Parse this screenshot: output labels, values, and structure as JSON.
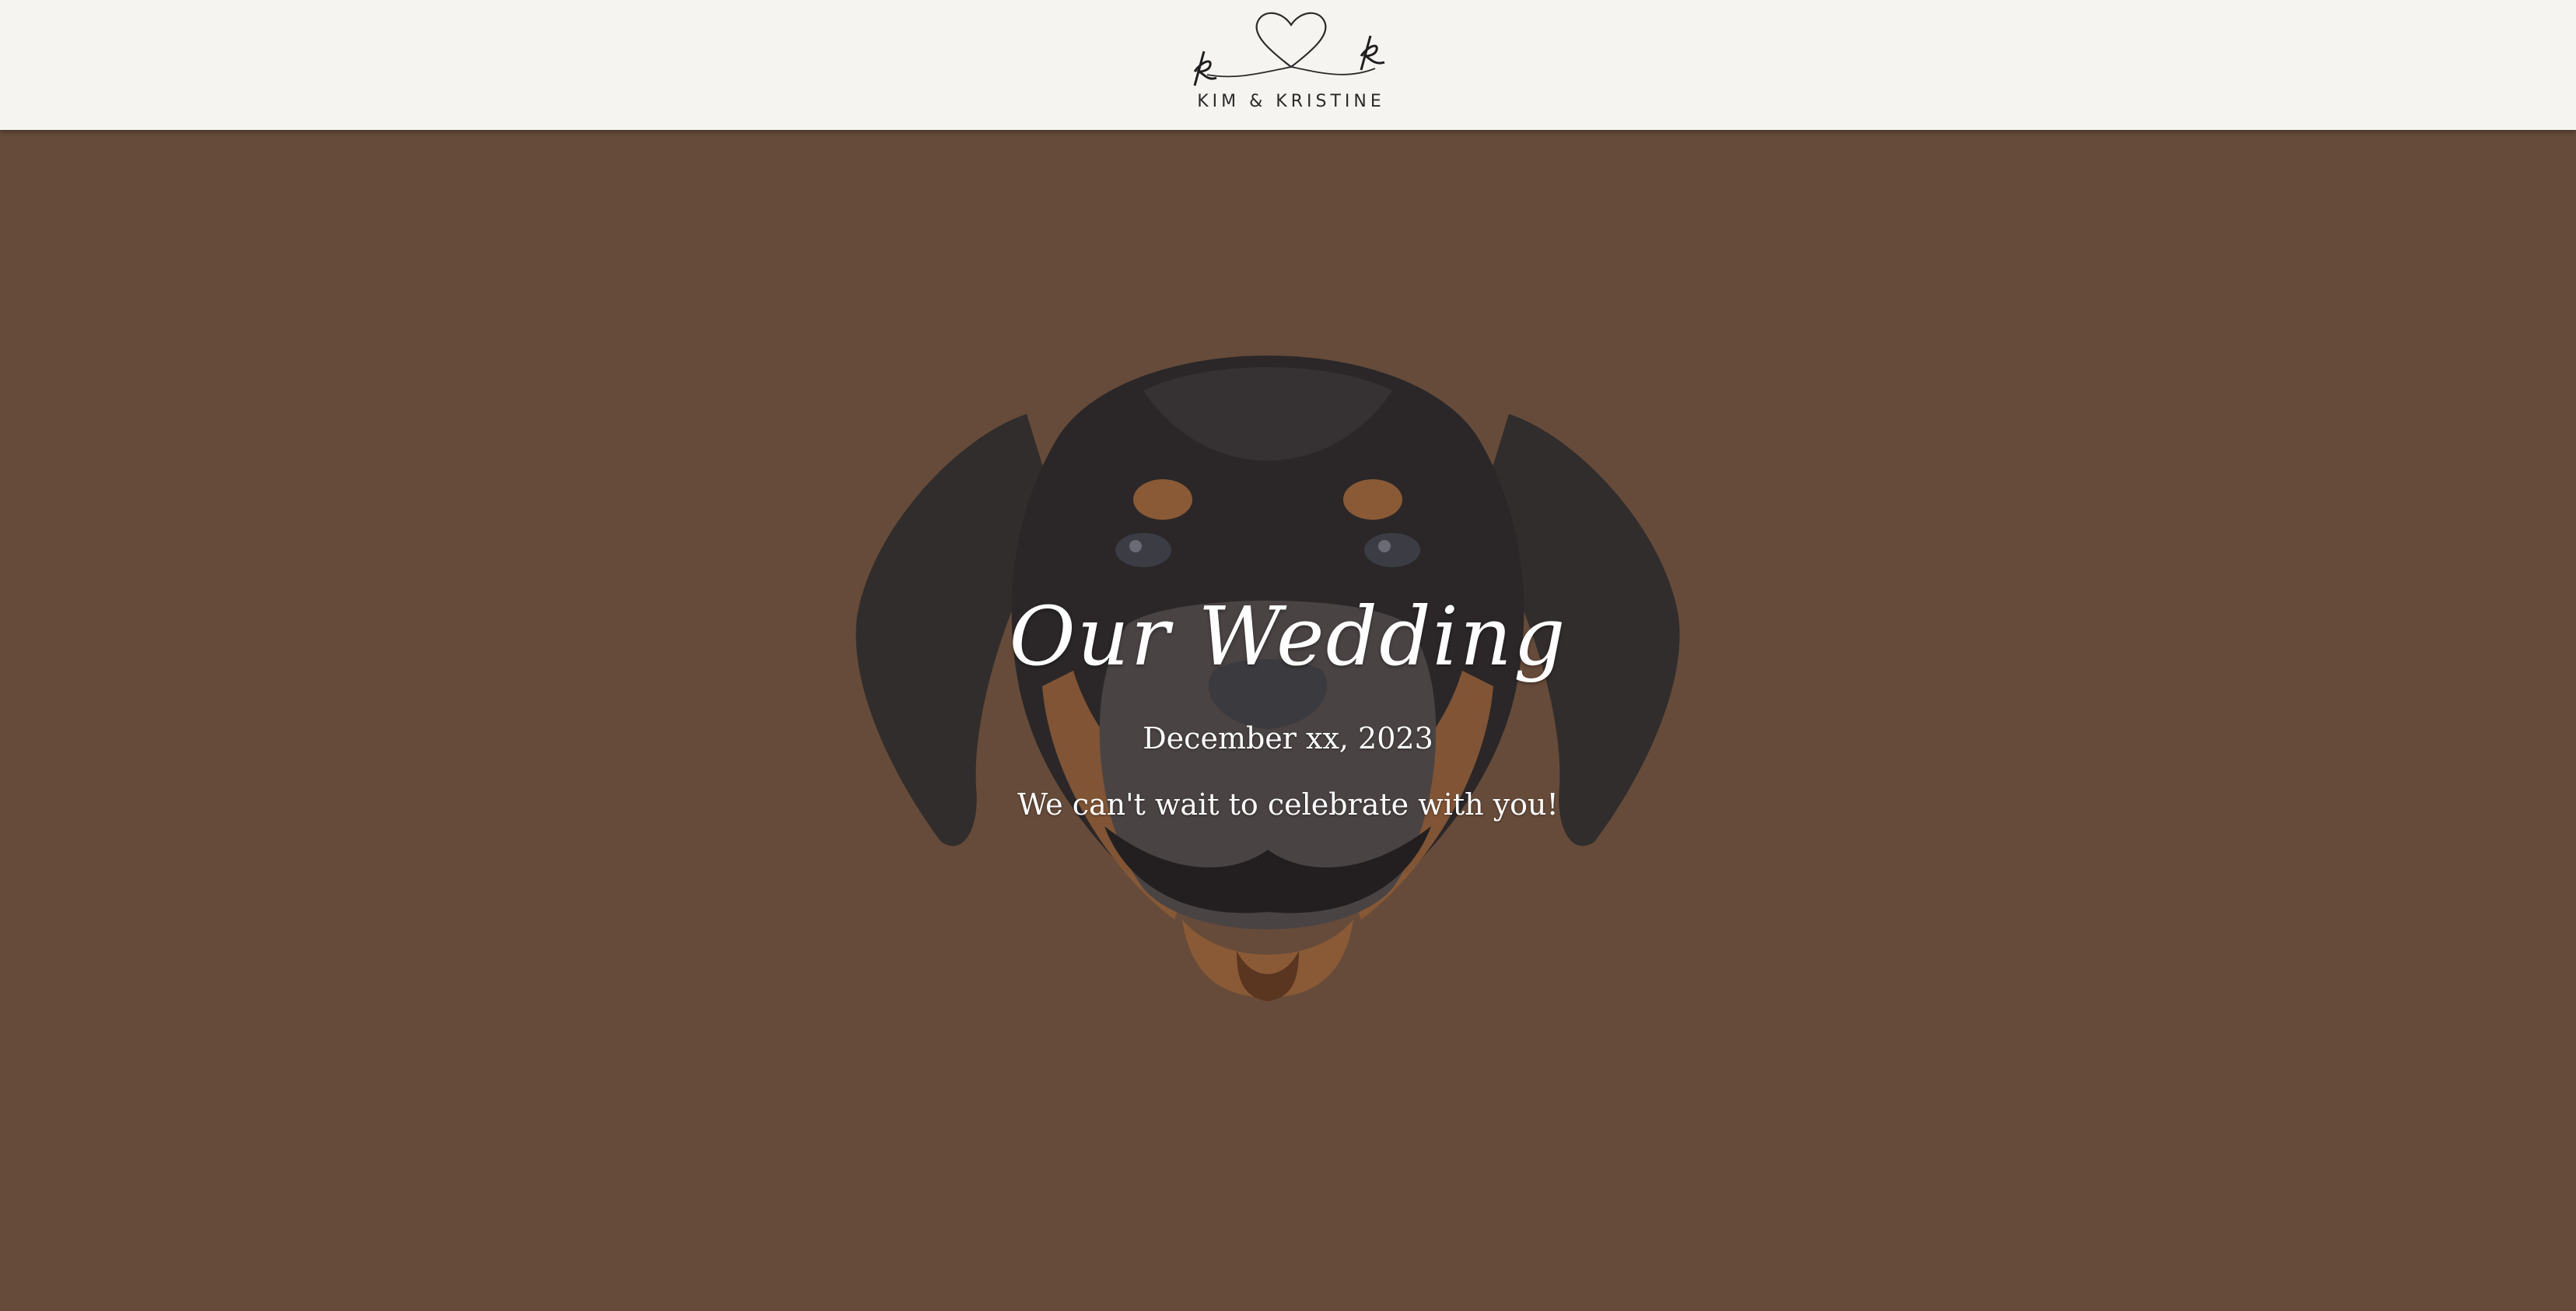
{
  "header": {
    "logo_text": "KIM & KRISTINE",
    "logo_icon": "kk-heart-monogram-icon"
  },
  "hero": {
    "title": "Our Wedding",
    "date": "December xx, 2023",
    "tagline": "We can't wait to celebrate with you!",
    "image": "rottweiler-puppy-illustration"
  },
  "colors": {
    "header_bg": "#f5f4f0",
    "hero_bg": "#664b3a",
    "text": "#ffffff"
  }
}
